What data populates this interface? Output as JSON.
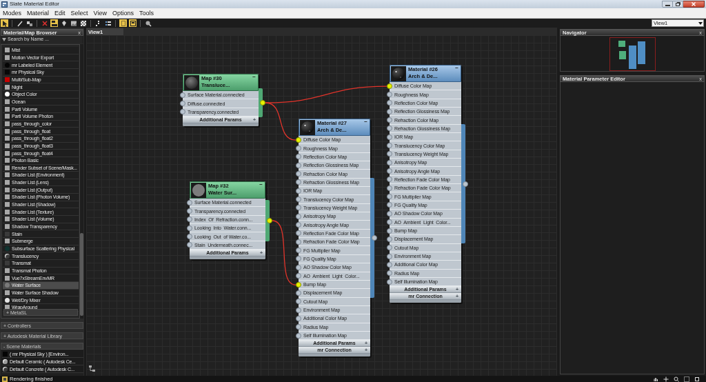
{
  "window": {
    "title": "Slate Material Editor"
  },
  "menu": [
    "Modes",
    "Material",
    "Edit",
    "Select",
    "View",
    "Options",
    "Tools"
  ],
  "toolbar": [
    {
      "active": true
    },
    {
      "active": false
    },
    {
      "active": false
    },
    {
      "active": false
    },
    {
      "active": true
    },
    {
      "active": false
    },
    {
      "active": false
    },
    {
      "active": false
    },
    {
      "active": false
    },
    {
      "active": false
    },
    {
      "active": true
    },
    {
      "active": true
    },
    {
      "active": false
    }
  ],
  "view_selector": {
    "value": "View1"
  },
  "browser": {
    "title": "Material/Map Browser",
    "close": "x",
    "search": {
      "placeholder": "Search by Name ..."
    },
    "items": [
      {
        "label": "Mist",
        "kind": "square",
        "color": "#a8a8a8",
        "selected": false
      },
      {
        "label": "Motion Vector Export",
        "kind": "square",
        "color": "#a8a8a8",
        "selected": false
      },
      {
        "label": "mr Labeled Element",
        "kind": "circle",
        "color": "#050505",
        "selected": false
      },
      {
        "label": "mr Physical Sky",
        "kind": "square",
        "color": "#080808",
        "selected": false
      },
      {
        "label": "Multi/Sub-Map",
        "kind": "square",
        "color": "#c40000",
        "selected": false
      },
      {
        "label": "Night",
        "kind": "square",
        "color": "#a8a8a8",
        "selected": false
      },
      {
        "label": "Object Color",
        "kind": "circle",
        "color": "#ffffff",
        "selected": false
      },
      {
        "label": "Ocean",
        "kind": "square",
        "color": "#a8a8a8",
        "selected": false
      },
      {
        "label": "Parti Volume",
        "kind": "square",
        "color": "#a8a8a8",
        "selected": false
      },
      {
        "label": "Parti Volume Photon",
        "kind": "square",
        "color": "#a8a8a8",
        "selected": false
      },
      {
        "label": "pass_through_color",
        "kind": "square",
        "color": "#a8a8a8",
        "selected": false
      },
      {
        "label": "pass_through_float",
        "kind": "square",
        "color": "#a8a8a8",
        "selected": false
      },
      {
        "label": "pass_through_float2",
        "kind": "square",
        "color": "#a8a8a8",
        "selected": false
      },
      {
        "label": "pass_through_float3",
        "kind": "square",
        "color": "#a8a8a8",
        "selected": false
      },
      {
        "label": "pass_through_float4",
        "kind": "square",
        "color": "#a8a8a8",
        "selected": false
      },
      {
        "label": "Photon Basic",
        "kind": "square",
        "color": "#a8a8a8",
        "selected": false
      },
      {
        "label": "Render Subset of Scene/Mask...",
        "kind": "square",
        "color": "#a8a8a8",
        "selected": false
      },
      {
        "label": "Shader List (Environment)",
        "kind": "square",
        "color": "#a8a8a8",
        "selected": false
      },
      {
        "label": "Shader List (Lens)",
        "kind": "square",
        "color": "#a8a8a8",
        "selected": false
      },
      {
        "label": "Shader List (Output)",
        "kind": "square",
        "color": "#a8a8a8",
        "selected": false
      },
      {
        "label": "Shader List (Photon Volume)",
        "kind": "square",
        "color": "#a8a8a8",
        "selected": false
      },
      {
        "label": "Shader List (Shadow)",
        "kind": "square",
        "color": "#a8a8a8",
        "selected": false
      },
      {
        "label": "Shader List (Texture)",
        "kind": "square",
        "color": "#a8a8a8",
        "selected": false
      },
      {
        "label": "Shader List (Volume)",
        "kind": "square",
        "color": "#a8a8a8",
        "selected": false
      },
      {
        "label": "Shadow Transparency",
        "kind": "square",
        "color": "#a8a8a8",
        "selected": false
      },
      {
        "label": "Stain",
        "kind": "square",
        "color": "#3a3a3a",
        "selected": false
      },
      {
        "label": "Submerge",
        "kind": "square",
        "color": "#a8a8a8",
        "selected": false
      },
      {
        "label": "Subsurface Scattering Physical",
        "kind": "circle",
        "color": "#0f3330",
        "selected": false
      },
      {
        "label": "Translucency",
        "kind": "sphere",
        "color": "#3c3c3c",
        "selected": false
      },
      {
        "label": "Transmat",
        "kind": "square",
        "color": "#3a3a3a",
        "selected": false
      },
      {
        "label": "Transmat Photon",
        "kind": "square",
        "color": "#a8a8a8",
        "selected": false
      },
      {
        "label": "Vue7xStreamEnvMR",
        "kind": "square",
        "color": "#a8a8a8",
        "selected": false
      },
      {
        "label": "Water Surface",
        "kind": "circle",
        "color": "#7a7a7a",
        "selected": true
      },
      {
        "label": "Water Surface Shadow",
        "kind": "square",
        "color": "#a8a8a8",
        "selected": false
      },
      {
        "label": "Wet/Dry Mixer",
        "kind": "circle",
        "color": "#e4e4e4",
        "selected": false
      },
      {
        "label": "WrapAround",
        "kind": "square",
        "color": "#a8a8a8",
        "selected": false
      }
    ],
    "categories": [
      {
        "label": "+ MetaSL",
        "kind": "sub"
      },
      {
        "label": "+ Controllers",
        "kind": "section"
      },
      {
        "label": "+ Autodesk Material Library",
        "kind": "section"
      },
      {
        "label": "- Scene Materials",
        "kind": "section",
        "items": [
          {
            "label": "( mr Physical Sky ) [Environ...",
            "kind": "square",
            "color": "#050505"
          },
          {
            "label": "Default Ceramic ( Autodesk Ce...",
            "kind": "sphere",
            "color": "#9a9a9a"
          },
          {
            "label": "Default Concrete ( Autodesk C...",
            "kind": "sphere",
            "color": "#3a3a3a"
          }
        ]
      }
    ]
  },
  "view_tabs": [
    {
      "label": "View1",
      "selected": true
    }
  ],
  "nodes": [
    {
      "kind": "map",
      "title": "Map #30",
      "subtitle": "Transluce...",
      "minimize": "−",
      "output_connected": true,
      "slots": [
        {
          "label": "Surface Material.connected",
          "connected": false
        },
        {
          "label": "Diffuse.connected",
          "connected": false
        },
        {
          "label": "Transparency.connected",
          "connected": false
        }
      ],
      "rollouts": [
        {
          "label": "Additional Params",
          "toggle": "+"
        }
      ]
    },
    {
      "kind": "map",
      "title": "Map #32",
      "subtitle": "Water Sur...",
      "minimize": "−",
      "output_connected": true,
      "slots": [
        {
          "label": "Surface Material.connected",
          "connected": false
        },
        {
          "label": "Transparency.connected",
          "connected": false
        },
        {
          "label": "Index  Of  Refraction.conn...",
          "connected": false
        },
        {
          "label": "Looking  Into  Water.conn...",
          "connected": false
        },
        {
          "label": "Looking  Out  of Water.co...",
          "connected": false
        },
        {
          "label": "Stain  Underneath.connec...",
          "connected": false
        }
      ],
      "rollouts": [
        {
          "label": "Additional Params",
          "toggle": "+"
        }
      ]
    },
    {
      "kind": "material",
      "title": "Material #27",
      "subtitle": "Arch & De...",
      "minimize": "−",
      "output_connected": false,
      "slots": [
        {
          "label": "Diffuse Color Map",
          "connected": true
        },
        {
          "label": "Roughness Map",
          "connected": false
        },
        {
          "label": "Reflection Color Map",
          "connected": false
        },
        {
          "label": "Reflection Glossiness Map",
          "connected": false
        },
        {
          "label": "Refraction Color Map",
          "connected": false
        },
        {
          "label": "Refraction Glossiness Map",
          "connected": false
        },
        {
          "label": "IOR Map",
          "connected": false
        },
        {
          "label": "Translucency Color Map",
          "connected": false
        },
        {
          "label": "Translucency Weight Map",
          "connected": false
        },
        {
          "label": "Anisotropy Map",
          "connected": false
        },
        {
          "label": "Anisotropy Angle Map",
          "connected": false
        },
        {
          "label": "Reflection Fade Color Map",
          "connected": false
        },
        {
          "label": "Refraction Fade Color Map",
          "connected": false
        },
        {
          "label": "FG Multiplier Map",
          "connected": false
        },
        {
          "label": "FG Quality Map",
          "connected": false
        },
        {
          "label": "AO Shadow Color Map",
          "connected": false
        },
        {
          "label": "AO  Ambient  Light  Color...",
          "connected": false
        },
        {
          "label": "Bump Map",
          "connected": true
        },
        {
          "label": "Displacement Map",
          "connected": false
        },
        {
          "label": "Cutout Map",
          "connected": false
        },
        {
          "label": "Environment Map",
          "connected": false
        },
        {
          "label": "Additional Color Map",
          "connected": false
        },
        {
          "label": "Radius Map",
          "connected": false
        },
        {
          "label": "Self Illumination Map",
          "connected": false
        }
      ],
      "rollouts": [
        {
          "label": "Additional Params",
          "toggle": "+"
        },
        {
          "label": "mr Connection",
          "toggle": "+"
        }
      ]
    },
    {
      "kind": "material",
      "title": "Material #26",
      "subtitle": "Arch & De...",
      "minimize": "−",
      "output_connected": false,
      "slots": [
        {
          "label": "Diffuse Color Map",
          "connected": true
        },
        {
          "label": "Roughness Map",
          "connected": false
        },
        {
          "label": "Reflection Color Map",
          "connected": false
        },
        {
          "label": "Reflection Glossiness Map",
          "connected": false
        },
        {
          "label": "Refraction Color Map",
          "connected": false
        },
        {
          "label": "Refraction Glossiness Map",
          "connected": false
        },
        {
          "label": "IOR Map",
          "connected": false
        },
        {
          "label": "Translucency Color Map",
          "connected": false
        },
        {
          "label": "Translucency Weight Map",
          "connected": false
        },
        {
          "label": "Anisotropy Map",
          "connected": false
        },
        {
          "label": "Anisotropy Angle Map",
          "connected": false
        },
        {
          "label": "Reflection Fade Color Map",
          "connected": false
        },
        {
          "label": "Refraction Fade Color Map",
          "connected": false
        },
        {
          "label": "FG Multiplier Map",
          "connected": false
        },
        {
          "label": "FG Quality Map",
          "connected": false
        },
        {
          "label": "AO Shadow Color Map",
          "connected": false
        },
        {
          "label": "AO  Ambient  Light  Color...",
          "connected": false
        },
        {
          "label": "Bump Map",
          "connected": false
        },
        {
          "label": "Displacement Map",
          "connected": false
        },
        {
          "label": "Cutout Map",
          "connected": false
        },
        {
          "label": "Environment Map",
          "connected": false
        },
        {
          "label": "Additional Color Map",
          "connected": false
        },
        {
          "label": "Radius Map",
          "connected": false
        },
        {
          "label": "Self Illumination Map",
          "connected": false
        }
      ],
      "rollouts": [
        {
          "label": "Additional Params",
          "toggle": "+"
        },
        {
          "label": "mr Connection",
          "toggle": "+"
        }
      ]
    }
  ],
  "navigator": {
    "title": "Navigator",
    "close": "x"
  },
  "parameter_editor": {
    "title": "Material Parameter Editor",
    "close": "x"
  },
  "status_bar": {
    "text": "Rendering finished"
  }
}
